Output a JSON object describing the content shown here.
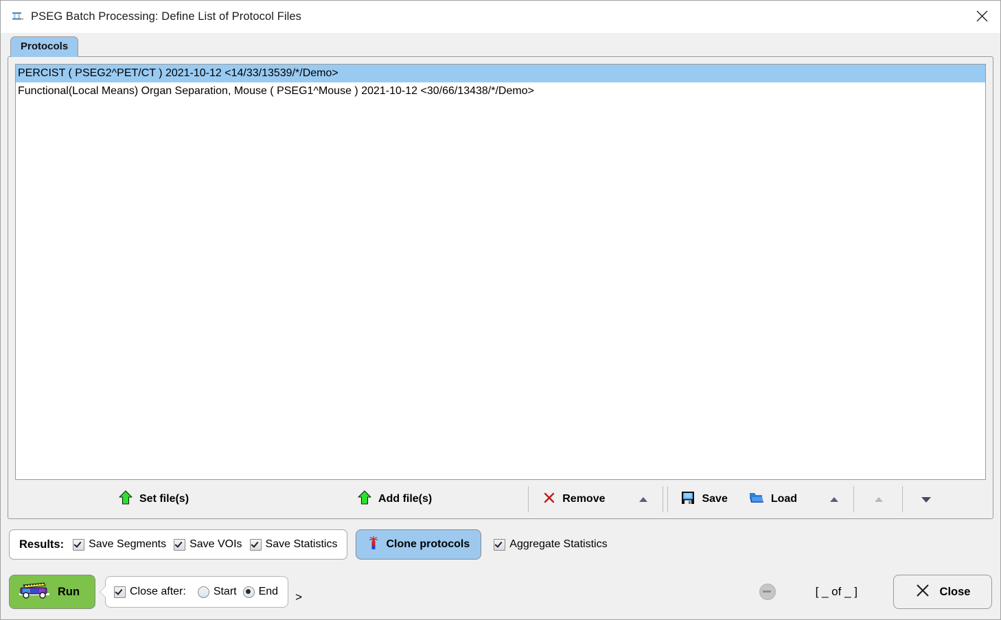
{
  "window": {
    "title": "PSEG Batch Processing: Define List of Protocol Files",
    "icon": "pseg-app-icon",
    "close_icon": "close-icon"
  },
  "tabs": [
    {
      "label": "Protocols",
      "active": true
    }
  ],
  "protocol_list": {
    "items": [
      {
        "text": "PERCIST ( PSEG2^PET/CT ) 2021-10-12 <14/33/13539/*/Demo>",
        "selected": true
      },
      {
        "text": "Functional(Local Means) Organ Separation, Mouse ( PSEG1^Mouse ) 2021-10-12 <30/66/13438/*/Demo>",
        "selected": false
      }
    ],
    "selection_color": "#99caf2"
  },
  "list_toolbar": {
    "set_files": {
      "label": "Set file(s)",
      "icon": "green-up-arrow-icon"
    },
    "add_files": {
      "label": "Add file(s)",
      "icon": "green-up-arrow-icon"
    },
    "remove": {
      "label": "Remove",
      "icon": "red-x-icon"
    },
    "remove_menu": {
      "icon": "triangle-up-icon"
    },
    "save": {
      "label": "Save",
      "icon": "floppy-disk-icon"
    },
    "load": {
      "label": "Load",
      "icon": "open-folder-icon"
    },
    "load_menu": {
      "icon": "triangle-up-icon"
    },
    "extra_up": {
      "icon": "triangle-up-icon-disabled"
    },
    "extra_down": {
      "icon": "triangle-down-icon"
    }
  },
  "results_bar": {
    "label": "Results:",
    "checkboxes": [
      {
        "label": "Save Segments",
        "checked": true
      },
      {
        "label": "Save VOIs",
        "checked": true
      },
      {
        "label": "Save Statistics",
        "checked": true
      }
    ],
    "clone_button": {
      "label": "Clone protocols",
      "icon": "clone-icon",
      "color": "#9dc9ef"
    },
    "aggregate": {
      "label": "Aggregate Statistics",
      "checked": true
    }
  },
  "bottom_bar": {
    "run": {
      "label": "Run",
      "icon": "truck-icon",
      "color": "#7dc24b"
    },
    "close_after": {
      "label": "Close after:",
      "checked": true,
      "options": [
        {
          "label": "Start",
          "selected": false
        },
        {
          "label": "End",
          "selected": true
        }
      ]
    },
    "expand_marker": ">",
    "stop_icon": "stop-disabled-icon",
    "page_indicator": "[ _ of _ ]",
    "close": {
      "label": "Close",
      "icon": "x-icon"
    }
  }
}
